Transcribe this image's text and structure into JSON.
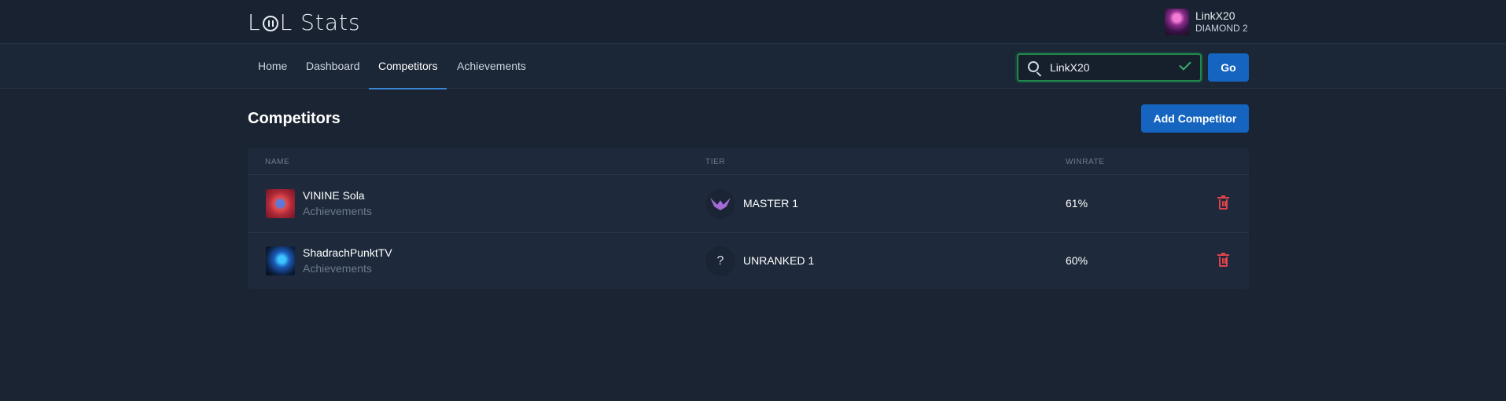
{
  "app": {
    "logo_text_pre": "L",
    "logo_text_post": "L Stats"
  },
  "user": {
    "name": "LinkX20",
    "rank": "DIAMOND 2"
  },
  "nav": {
    "items": [
      {
        "label": "Home"
      },
      {
        "label": "Dashboard"
      },
      {
        "label": "Competitors",
        "active": true
      },
      {
        "label": "Achievements"
      }
    ]
  },
  "search": {
    "value": "LinkX20",
    "valid": true,
    "go_label": "Go"
  },
  "page": {
    "title": "Competitors",
    "add_button_label": "Add Competitor"
  },
  "table": {
    "columns": [
      "NAME",
      "TIER",
      "WINRATE"
    ],
    "rows": [
      {
        "name": "VININE Sola",
        "sub_link": "Achievements",
        "tier_icon": "master-emblem-icon",
        "tier": "MASTER 1",
        "winrate": "61%"
      },
      {
        "name": "ShadrachPunktTV",
        "sub_link": "Achievements",
        "tier_icon": "question-mark-icon",
        "tier_glyph": "?",
        "tier": "UNRANKED 1",
        "winrate": "60%"
      }
    ]
  },
  "colors": {
    "background": "#1b2433",
    "accent": "#1565c0",
    "valid": "#1f8a4a",
    "danger": "#e0424a"
  }
}
